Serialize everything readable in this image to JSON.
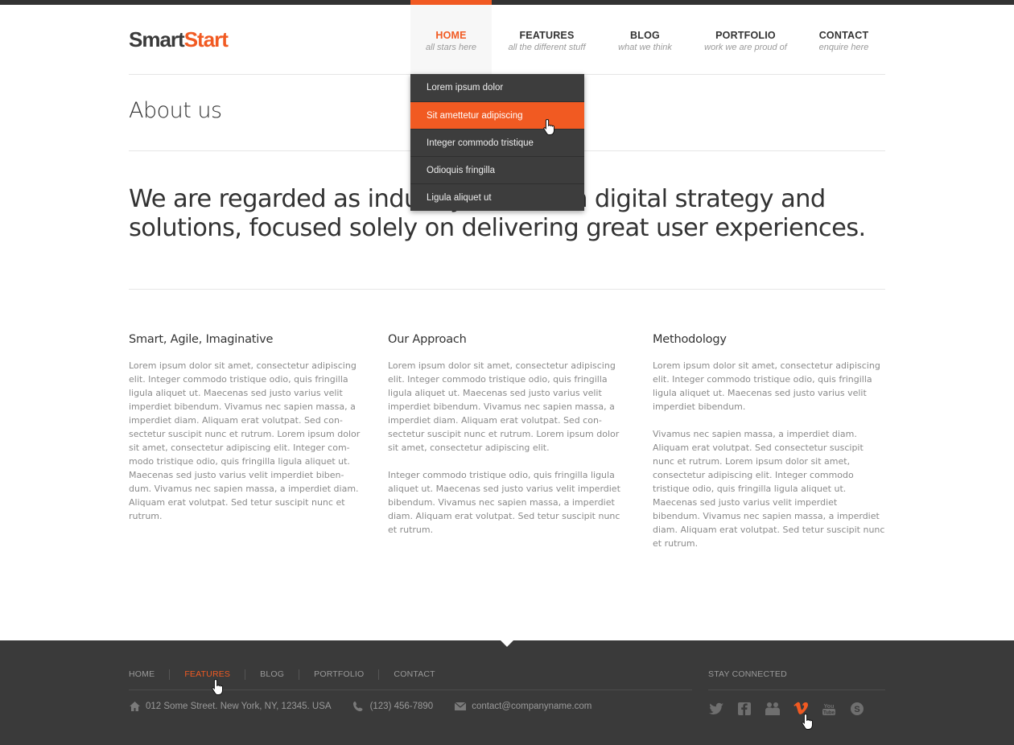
{
  "logo": {
    "part1": "Smart",
    "part2": "Start"
  },
  "nav": [
    {
      "label": "HOME",
      "sub": "all stars here"
    },
    {
      "label": "FEATURES",
      "sub": "all the different stuff"
    },
    {
      "label": "BLOG",
      "sub": "what we think"
    },
    {
      "label": "PORTFOLIO",
      "sub": "work we are proud of"
    },
    {
      "label": "CONTACT",
      "sub": "enquire here"
    }
  ],
  "dropdown": [
    "Lorem ipsum dolor",
    "Sit amettetur adipiscing",
    "Integer commodo tristique",
    "Odioquis fringilla",
    "Ligula aliquet ut"
  ],
  "page_title": "About us",
  "intro": "We are regarded as industry leaders in digital strategy and solutions, focused solely on delivering great user experiences.",
  "columns": [
    {
      "title": "Smart, Agile, Imaginative",
      "paragraphs": [
        "Lorem ipsum dolor sit amet, consectetur adipiscing elit. Integer commodo tristique odio, quis fringilla ligula aliquet ut. Maecenas sed justo varius velit imperdiet bibendum. Vivamus nec sapien massa, a imperdiet diam. Aliquam erat volutpat. Sed con-sectetur suscipit nunc et rutrum. Lorem ipsum dolor sit amet, consectetur adipiscing elit. Integer com-modo tristique odio, quis fringilla ligula aliquet ut. Maecenas sed justo varius velit imperdiet biben-dum. Vivamus nec sapien massa, a imperdiet diam. Aliquam erat volutpat. Sed tetur suscipit nunc et rutrum."
      ]
    },
    {
      "title": "Our Approach",
      "paragraphs": [
        "Lorem ipsum dolor sit amet, consectetur adipiscing elit. Integer commodo tristique odio, quis fringilla ligula aliquet ut. Maecenas sed justo varius velit imperdiet bibendum. Vivamus nec sapien massa, a imperdiet diam. Aliquam erat volutpat. Sed con-sectetur suscipit nunc et rutrum. Lorem ipsum dolor sit amet, consectetur adipiscing elit.",
        "Integer commodo tristique odio, quis fringilla ligula aliquet ut. Maecenas sed justo varius velit imperdiet bibendum. Vivamus nec sapien massa, a imperdiet diam. Aliquam erat volutpat. Sed tetur suscipit nunc et rutrum."
      ]
    },
    {
      "title": "Methodology",
      "paragraphs": [
        "Lorem ipsum dolor sit amet, consectetur adipiscing elit. Integer commodo tristique odio, quis fringilla ligula aliquet ut. Maecenas sed justo varius velit imperdiet bibendum.",
        "Vivamus nec sapien massa, a imperdiet diam. Aliquam erat volutpat. Sed consectetur suscipit nunc et rutrum. Lorem ipsum dolor sit amet, consectetur adipiscing elit. Integer commodo tristique odio, quis fringilla ligula aliquet ut. Maecenas sed justo varius velit imperdiet bibendum. Vivamus nec sapien massa, a imperdiet diam. Aliquam erat volutpat. Sed tetur suscipit nunc et rutrum."
      ]
    }
  ],
  "footer": {
    "nav": [
      "HOME",
      "FEATURES",
      "BLOG",
      "PORTFOLIO",
      "CONTACT"
    ],
    "address": "012 Some Street. New York, NY, 12345. USA",
    "phone": "(123) 456-7890",
    "email": "contact@companyname.com",
    "stay_connected": "STAY CONNECTED",
    "social_icons": [
      "twitter-icon",
      "facebook-icon",
      "flickr-icon",
      "vimeo-icon",
      "youtube-icon",
      "skype-icon"
    ]
  },
  "colors": {
    "accent": "#f15a22",
    "dark": "#3a3a3a",
    "text": "#333333",
    "muted": "#8a8a8a"
  }
}
